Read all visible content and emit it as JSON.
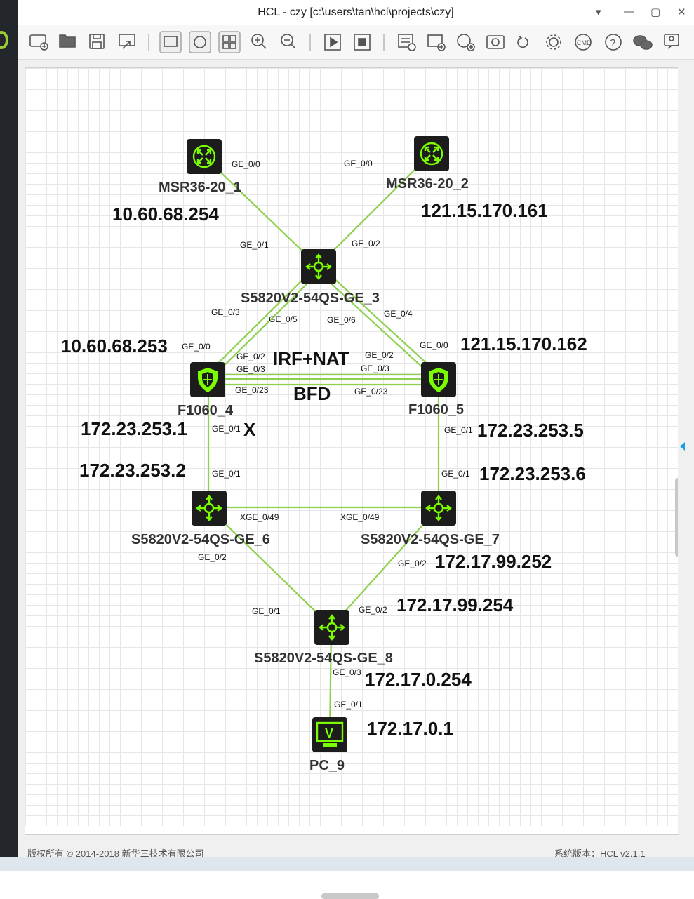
{
  "window": {
    "title": "HCL - czy [c:\\users\\tan\\hcl\\projects\\czy]",
    "controls": [
      "▾",
      "—",
      "▢",
      "✕"
    ]
  },
  "toolbar": {
    "icons": [
      "new-project-icon",
      "open-project-icon",
      "save-icon",
      "export-icon",
      "display-interface-icon",
      "device-view-icon",
      "grid-icon",
      "zoom-in-icon",
      "zoom-out-icon",
      "start-all-icon",
      "stop-all-icon",
      "collect-icon",
      "add-device-icon",
      "add-link-icon",
      "snapshot-icon",
      "undo-icon",
      "settings-icon",
      "cmd-icon",
      "help-icon",
      "wechat-icon",
      "feedback-icon"
    ]
  },
  "topology": {
    "devices": [
      {
        "id": "msr1",
        "name": "MSR36-20_1",
        "type": "router"
      },
      {
        "id": "msr2",
        "name": "MSR36-20_2",
        "type": "router"
      },
      {
        "id": "sw3",
        "name": "S5820V2-54QS-GE_3",
        "type": "switch"
      },
      {
        "id": "fw4",
        "name": "F1060_4",
        "type": "firewall"
      },
      {
        "id": "fw5",
        "name": "F1060_5",
        "type": "firewall"
      },
      {
        "id": "sw6",
        "name": "S5820V2-54QS-GE_6",
        "type": "switch"
      },
      {
        "id": "sw7",
        "name": "S5820V2-54QS-GE_7",
        "type": "switch"
      },
      {
        "id": "sw8",
        "name": "S5820V2-54QS-GE_8",
        "type": "switch"
      },
      {
        "id": "pc9",
        "name": "PC_9",
        "type": "pc"
      }
    ],
    "ip_labels": {
      "msr1": "10.60.68.254",
      "msr2": "121.15.170.161",
      "fw4_up": "10.60.68.253",
      "fw5_up": "121.15.170.162",
      "fw4_down": "172.23.253.1",
      "fw5_down": "172.23.253.5",
      "sw6_up": "172.23.253.2",
      "sw7_up": "172.23.253.6",
      "sw7_down": "172.17.99.252",
      "sw8_up": "172.17.99.254",
      "sw8_down": "172.17.0.254",
      "pc9": "172.17.0.1"
    },
    "notes": {
      "irf": "IRF+NAT",
      "bfd": "BFD",
      "fail_mark": "X"
    },
    "ports": {
      "msr1_g0": "GE_0/0",
      "msr2_g0": "GE_0/0",
      "sw3_g1": "GE_0/1",
      "sw3_g2": "GE_0/2",
      "sw3_g3": "GE_0/3",
      "sw3_g5": "GE_0/5",
      "sw3_g6": "GE_0/6",
      "sw3_g4": "GE_0/4",
      "fw4_g0": "GE_0/0",
      "fw4_g2": "GE_0/2",
      "fw4_g3": "GE_0/3",
      "fw4_g23": "GE_0/23",
      "fw4_g1": "GE_0/1",
      "fw5_g0": "GE_0/0",
      "fw5_g2": "GE_0/2",
      "fw5_g3": "GE_0/3",
      "fw5_g23": "GE_0/23",
      "fw5_g1": "GE_0/1",
      "sw6_g1": "GE_0/1",
      "sw6_x49": "XGE_0/49",
      "sw6_g2": "GE_0/2",
      "sw7_g1": "GE_0/1",
      "sw7_x49": "XGE_0/49",
      "sw7_g2": "GE_0/2",
      "sw8_g1": "GE_0/1",
      "sw8_g2": "GE_0/2",
      "sw8_g3": "GE_0/3",
      "pc9_g1": "GE_0/1"
    },
    "colors": {
      "link": "#8cd04c",
      "icon_bg": "#1c1c1c",
      "icon_fg": "#7cfc00"
    }
  },
  "footer": {
    "left": "版权所有 © 2014-2018 新华三技术有限公司",
    "right": "系统版本：HCL v2.1.1"
  }
}
